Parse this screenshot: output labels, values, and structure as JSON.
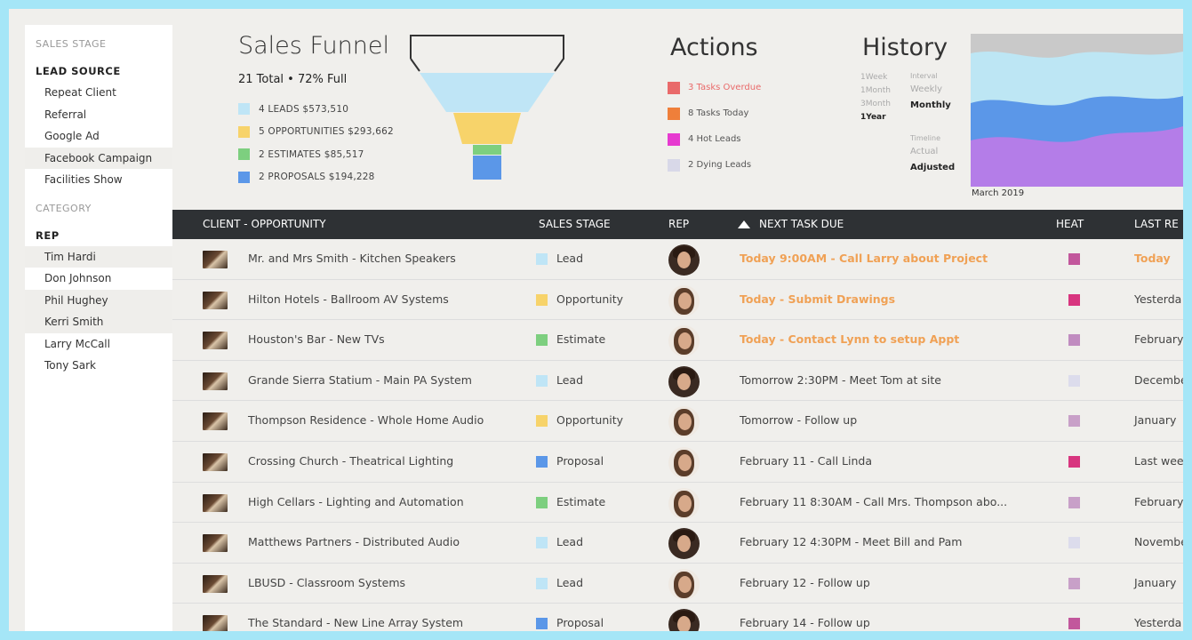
{
  "sidebar": {
    "sales_stage_label": "SALES STAGE",
    "lead_source_label": "LEAD SOURCE",
    "lead_sources": [
      "Repeat Client",
      "Referral",
      "Google Ad",
      "Facebook Campaign",
      "Facilities Show"
    ],
    "category_label": "CATEGORY",
    "rep_label": "REP",
    "reps": [
      "Tim Hardi",
      "Don Johnson",
      "Phil Hughey",
      "Kerri Smith",
      "Larry McCall",
      "Tony Sark"
    ]
  },
  "funnel": {
    "title": "Sales Funnel",
    "summary": "21 Total  •  72% Full",
    "legend": [
      {
        "label": "4 LEADS  $573,510",
        "color": "#bfe5f6"
      },
      {
        "label": "5 OPPORTUNITIES  $293,662",
        "color": "#f7d36a"
      },
      {
        "label": "2  ESTIMATES  $85,517",
        "color": "#7dcf7f"
      },
      {
        "label": "2  PROPOSALS   $194,228",
        "color": "#5b97e8"
      }
    ]
  },
  "actions": {
    "title": "Actions",
    "items": [
      {
        "label": "3 Tasks Overdue",
        "color": "#e96a6a",
        "text_color": "#e96a6a"
      },
      {
        "label": "8 Tasks Today",
        "color": "#ef7f3a",
        "text_color": "#555"
      },
      {
        "label": "4 Hot Leads",
        "color": "#e63ad0",
        "text_color": "#555"
      },
      {
        "label": "2 Dying Leads",
        "color": "#d8d8e8",
        "text_color": "#555"
      }
    ]
  },
  "history": {
    "title": "History",
    "periods": [
      "1Week",
      "1Month",
      "3Month",
      "1Year"
    ],
    "interval_label": "Interval",
    "intervals": [
      "Weekly",
      "Monthly"
    ],
    "timeline_label": "Timeline",
    "timelines": [
      "Actual",
      "Adjusted"
    ],
    "date": "March 2019"
  },
  "table": {
    "headers": {
      "client": "CLIENT - OPPORTUNITY",
      "stage": "SALES STAGE",
      "rep": "REP",
      "task": "NEXT TASK DUE",
      "heat": "HEAT",
      "last": "LAST RE"
    },
    "rows": [
      {
        "client": "Mr. and Mrs Smith - Kitchen Speakers",
        "stage": "Lead",
        "task": "Today 9:00AM - Call Larry about Project",
        "last": "Today"
      },
      {
        "client": "Hilton Hotels - Ballroom AV Systems",
        "stage": "Opportunity",
        "task": "Today - Submit Drawings",
        "last": "Yesterda"
      },
      {
        "client": "Houston's Bar - New TVs",
        "stage": "Estimate",
        "task": "Today - Contact Lynn to setup Appt",
        "last": "February"
      },
      {
        "client": "Grande Sierra Statium - Main PA System",
        "stage": "Lead",
        "task": "Tomorrow 2:30PM - Meet Tom at site",
        "last": "Decembe"
      },
      {
        "client": "Thompson Residence - Whole Home Audio",
        "stage": "Opportunity",
        "task": "Tomorrow - Follow up",
        "last": "January"
      },
      {
        "client": "Crossing Church - Theatrical Lighting",
        "stage": "Proposal",
        "task": "February 11 - Call Linda",
        "last": "Last wee"
      },
      {
        "client": "High Cellars - Lighting and Automation",
        "stage": "Estimate",
        "task": "February 11 8:30AM - Call Mrs. Thompson abo...",
        "last": "February"
      },
      {
        "client": "Matthews Partners - Distributed Audio",
        "stage": "Lead",
        "task": "February 12 4:30PM - Meet Bill and Pam",
        "last": "Novembe"
      },
      {
        "client": "LBUSD - Classroom Systems",
        "stage": "Lead",
        "task": "February 12 - Follow up",
        "last": "January"
      },
      {
        "client": "The Standard - New Line Array System",
        "stage": "Proposal",
        "task": "February 14 - Follow up",
        "last": "Yesterda"
      }
    ]
  },
  "row_styles": [
    {
      "stage_color": "#bfe5f6",
      "heat": "#c2579c",
      "today": true,
      "avatar": "m"
    },
    {
      "stage_color": "#f7d36a",
      "heat": "#d8357f",
      "today": true,
      "avatar": "f"
    },
    {
      "stage_color": "#7dcf7f",
      "heat": "#c08cc0",
      "today": true,
      "avatar": "f"
    },
    {
      "stage_color": "#bfe5f6",
      "heat": "#dcdcec",
      "today": false,
      "avatar": "m"
    },
    {
      "stage_color": "#f7d36a",
      "heat": "#c8a0c8",
      "today": false,
      "avatar": "f"
    },
    {
      "stage_color": "#5b97e8",
      "heat": "#d8357f",
      "today": false,
      "avatar": "f"
    },
    {
      "stage_color": "#7dcf7f",
      "heat": "#c8a0c8",
      "today": false,
      "avatar": "f"
    },
    {
      "stage_color": "#bfe5f6",
      "heat": "#dcdcec",
      "today": false,
      "avatar": "m"
    },
    {
      "stage_color": "#bfe5f6",
      "heat": "#c8a0c8",
      "today": false,
      "avatar": "f"
    },
    {
      "stage_color": "#5b97e8",
      "heat": "#c2579c",
      "today": false,
      "avatar": "m"
    }
  ]
}
